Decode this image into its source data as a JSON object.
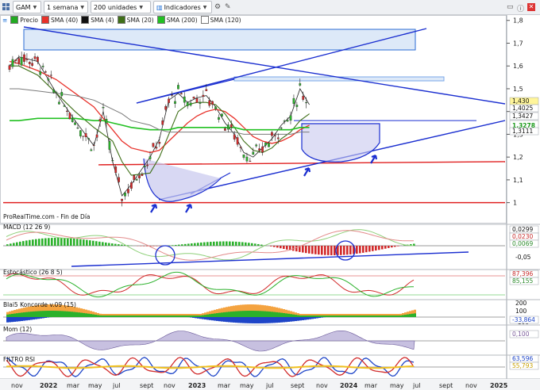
{
  "toolbar": {
    "ticker": "GAM",
    "period": "1 semana",
    "units": "200 unidades",
    "indicators": "Indicadores"
  },
  "legend": {
    "price": "Precio",
    "sma40": "SMA (40)",
    "sma4": "SMA (4)",
    "sma20": "SMA (20)",
    "sma200": "SMA (200)",
    "sma120": "SMA (120)"
  },
  "source": "ProRealTime.com - Fin de Día",
  "colors": {
    "sma40": "#e8322b",
    "sma4": "#111111",
    "sma20": "#3f6f18",
    "sma200": "#22c022",
    "sma120": "#7a7a7a",
    "trendline": "#1b2fd0",
    "support": "#e02020"
  },
  "price_axis": {
    "ticks": [
      "1,8",
      "1,7",
      "1,6",
      "1,5",
      "1,4",
      "1,3",
      "1,2",
      "1,1",
      "1"
    ],
    "tags": [
      {
        "text": "1,430",
        "bg": "#fff59a",
        "fg": "#111"
      },
      {
        "text": "1,4025",
        "bg": "#ffffff",
        "fg": "#111"
      },
      {
        "text": "1,3427",
        "bg": "#ffffff",
        "fg": "#111"
      },
      {
        "text": "1,3278",
        "bg": "#ffffff",
        "fg": "#1a9a1a"
      },
      {
        "text": "1,3111",
        "bg": "#ffffff",
        "fg": "#111"
      }
    ]
  },
  "time_axis": [
    "nov",
    "2022",
    "mar",
    "may",
    "jul",
    "sept",
    "nov",
    "2023",
    "mar",
    "may",
    "jul",
    "sept",
    "nov",
    "2024",
    "mar",
    "may",
    "jul",
    "sept",
    "nov",
    "2025"
  ],
  "panes": {
    "macd": {
      "label": "MACD (12 26 9)",
      "ticks": [
        "0,05",
        "-0,05"
      ],
      "tags": [
        "0,0299",
        "0,0230",
        "0,0069"
      ]
    },
    "stoch": {
      "label": "Estocástico (26 8 5)",
      "tags": [
        "87,396",
        "85,155"
      ]
    },
    "blai": {
      "label": "Blai5 Koncorde v.09 (15)",
      "ticks": [
        "200",
        "100",
        "-100"
      ],
      "tags": [
        "-33,864"
      ]
    },
    "mom": {
      "label": "Mom (12)",
      "tags": [
        "0,100"
      ]
    },
    "rsi": {
      "label": "FILTRO RSI",
      "tags": [
        "63,596",
        "55,793"
      ]
    }
  },
  "chart_data": {
    "type": "line",
    "title": "GAM",
    "xlabel": "",
    "ylabel": "",
    "ylim": [
      0.95,
      1.82
    ],
    "x": [
      "2021-10",
      "2021-11",
      "2022-01",
      "2022-03",
      "2022-05",
      "2022-07",
      "2022-08",
      "2022-09",
      "2022-10",
      "2022-11",
      "2023-01",
      "2023-02",
      "2023-03",
      "2023-04",
      "2023-05",
      "2023-06",
      "2023-07",
      "2023-08",
      "2023-09",
      "2023-10",
      "2023-11",
      "2023-12",
      "2024-01",
      "2024-02",
      "2024-03",
      "2024-04",
      "2024-05",
      "2024-06"
    ],
    "series": [
      {
        "name": "Precio",
        "values": [
          1.6,
          1.64,
          1.62,
          1.48,
          1.36,
          1.25,
          1.4,
          1.18,
          1.03,
          1.08,
          1.2,
          1.28,
          1.45,
          1.48,
          1.44,
          1.46,
          1.47,
          1.42,
          1.35,
          1.3,
          1.22,
          1.2,
          1.24,
          1.28,
          1.34,
          1.38,
          1.5,
          1.43
        ]
      },
      {
        "name": "SMA (40)",
        "values": [
          1.62,
          1.61,
          1.58,
          1.54,
          1.48,
          1.42,
          1.37,
          1.32,
          1.27,
          1.24,
          1.22,
          1.23,
          1.27,
          1.31,
          1.35,
          1.38,
          1.4,
          1.41,
          1.4,
          1.37,
          1.33,
          1.29,
          1.27,
          1.26,
          1.27,
          1.29,
          1.32,
          1.34
        ]
      },
      {
        "name": "SMA (20)",
        "values": [
          1.6,
          1.6,
          1.56,
          1.48,
          1.4,
          1.33,
          1.3,
          1.27,
          1.18,
          1.12,
          1.13,
          1.2,
          1.3,
          1.4,
          1.43,
          1.44,
          1.44,
          1.43,
          1.39,
          1.33,
          1.27,
          1.23,
          1.22,
          1.24,
          1.28,
          1.31,
          1.36,
          1.39
        ]
      },
      {
        "name": "SMA (200)",
        "values": [
          1.36,
          1.36,
          1.37,
          1.37,
          1.37,
          1.36,
          1.36,
          1.35,
          1.34,
          1.33,
          1.32,
          1.32,
          1.32,
          1.33,
          1.33,
          1.33,
          1.33,
          1.33,
          1.33,
          1.33,
          1.32,
          1.32,
          1.32,
          1.32,
          1.32,
          1.32,
          1.33,
          1.33
        ]
      },
      {
        "name": "SMA (120)",
        "values": [
          1.5,
          1.5,
          1.49,
          1.48,
          1.47,
          1.45,
          1.43,
          1.41,
          1.39,
          1.36,
          1.34,
          1.32,
          1.31,
          1.31,
          1.31,
          1.31,
          1.31,
          1.31,
          1.31,
          1.31,
          1.3,
          1.3,
          1.3,
          1.3,
          1.3,
          1.3,
          1.31,
          1.31
        ]
      }
    ],
    "horizontal_lines": [
      1.0,
      1.18
    ],
    "grid": false,
    "legend": "top-left"
  }
}
